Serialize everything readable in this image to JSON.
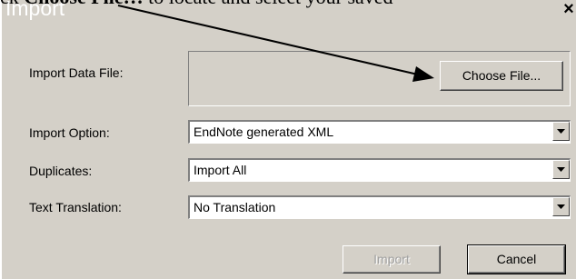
{
  "instruction": {
    "prefix": "ck ",
    "emphasis": "Choose File…",
    "suffix": " to locate and select your saved"
  },
  "dialog": {
    "title": "Import",
    "close_label": "×",
    "fields": {
      "data_file_label": "Import Data File:",
      "choose_file_button": "Choose File...",
      "import_option_label": "Import Option:",
      "import_option_value": "EndNote generated XML",
      "duplicates_label": "Duplicates:",
      "duplicates_value": "Import All",
      "translation_label": "Text Translation:",
      "translation_value": "No Translation"
    },
    "buttons": {
      "import": "Import",
      "cancel": "Cancel"
    }
  }
}
